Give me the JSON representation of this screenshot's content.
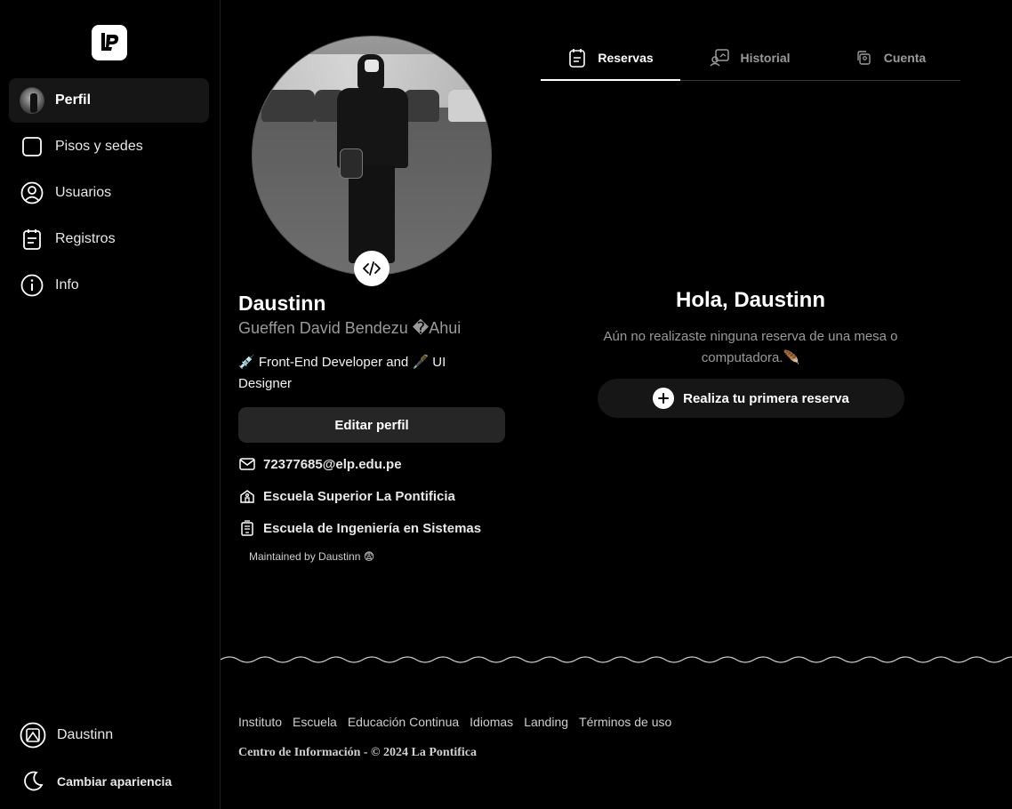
{
  "sidebar": {
    "logo_icon": "lp-logo-icon",
    "items": [
      {
        "label": "Perfil",
        "icon": "avatar",
        "active": true
      },
      {
        "label": "Pisos y sedes",
        "icon": "square-icon"
      },
      {
        "label": "Usuarios",
        "icon": "user-circle-icon"
      },
      {
        "label": "Registros",
        "icon": "clipboard-icon"
      },
      {
        "label": "Info",
        "icon": "info-icon"
      }
    ],
    "user": {
      "label": "Daustinn",
      "icon": "user-badge-icon"
    },
    "theme": {
      "label": "Cambiar apariencia",
      "icon": "moon-icon"
    }
  },
  "profile": {
    "username": "Daustinn",
    "full_name": "Gueffen David Bendezu �Ahui",
    "bio": "💉 Front-End Developer and 🖋️ UI Designer",
    "edit_label": "Editar perfil",
    "email": "72377685@elp.edu.pe",
    "school": "Escuela Superior La Pontificia",
    "faculty": "Escuela de Ingeniería en Sistemas",
    "maintained": "Maintained by Daustinn 😨"
  },
  "tabs": [
    {
      "label": "Reservas",
      "icon": "calendar-note-icon",
      "active": true
    },
    {
      "label": "Historial",
      "icon": "history-icon"
    },
    {
      "label": "Cuenta",
      "icon": "account-icon"
    }
  ],
  "main": {
    "greeting": "Hola, Daustinn",
    "message": "Aún no realizaste ninguna reserva de una mesa o computadora.🪶",
    "cta_label": "Realiza tu primera reserva"
  },
  "footer": {
    "links": [
      "Instituto",
      "Escuela",
      "Educación Continua",
      "Idiomas",
      "Landing",
      "Términos de uso"
    ],
    "copyright": "Centro de Información - © 2024 La Pontifica"
  }
}
